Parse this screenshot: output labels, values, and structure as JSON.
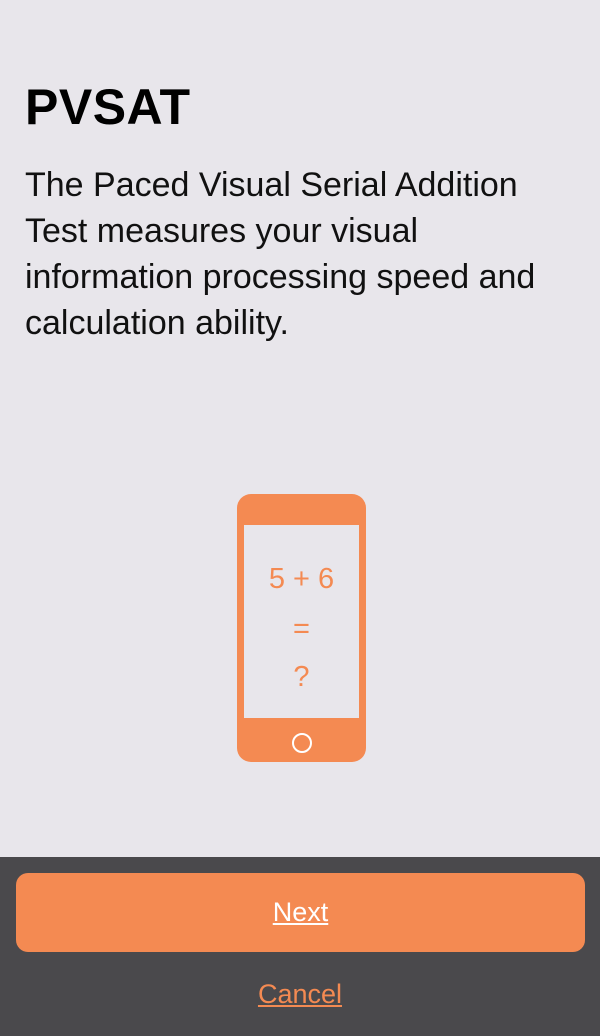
{
  "header": {
    "title": "PVSAT",
    "description": "The Paced Visual Serial Addition Test measures your visual information processing speed and calculation ability."
  },
  "illustration": {
    "icon": "phone-illustration",
    "equation_line_1": "5 + 6",
    "equation_line_2": "=",
    "equation_line_3": "?"
  },
  "footer": {
    "next_label": "Next",
    "cancel_label": "Cancel"
  },
  "colors": {
    "accent": "#f48a52",
    "background": "#e8e6eb",
    "footer_background": "#4a494c"
  }
}
